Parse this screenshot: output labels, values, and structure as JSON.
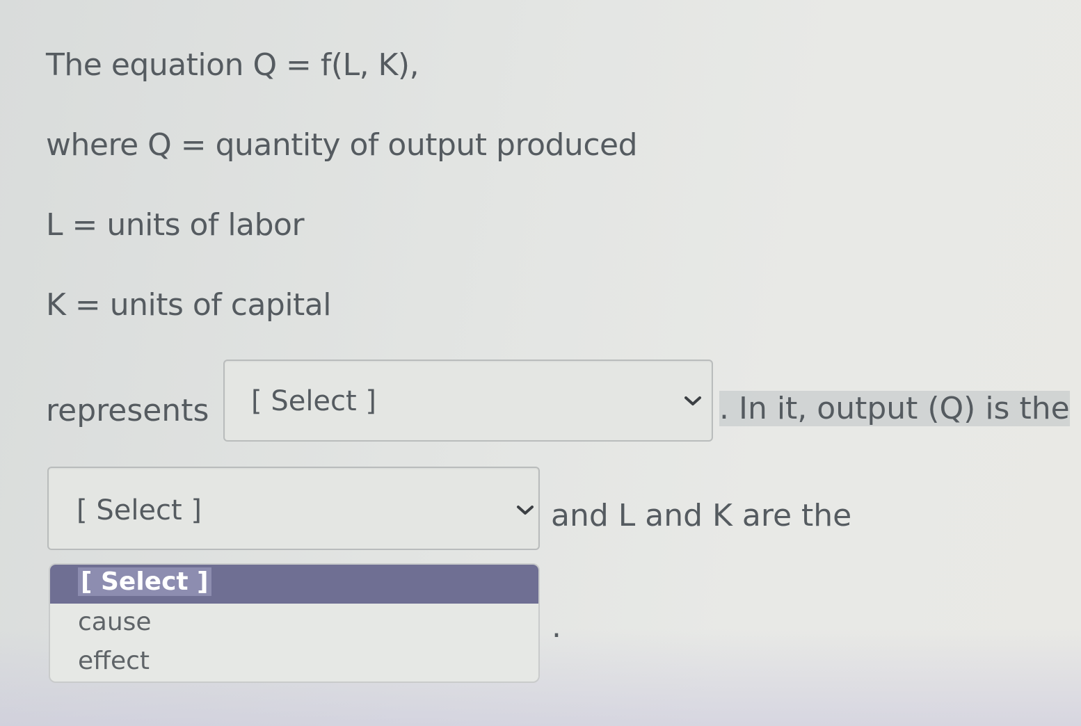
{
  "question": {
    "line1": "The equation Q = f(L, K),",
    "line2": "where Q = quantity of output produced",
    "line3": "L = units of labor",
    "line4": "K = units of capital",
    "represents": "represents",
    "after_select1": ". In it, output (Q) is the",
    "after_select2": "and L and K are the",
    "trailing_period": "."
  },
  "select1": {
    "value": "[ Select ]"
  },
  "select2": {
    "value": "[ Select ]",
    "options": [
      "[ Select ]",
      "cause",
      "effect"
    ],
    "highlighted": "[ Select ]"
  },
  "colors": {
    "text": "#555b60",
    "highlight": "#6f6f93",
    "border": "#b9bcbc"
  }
}
